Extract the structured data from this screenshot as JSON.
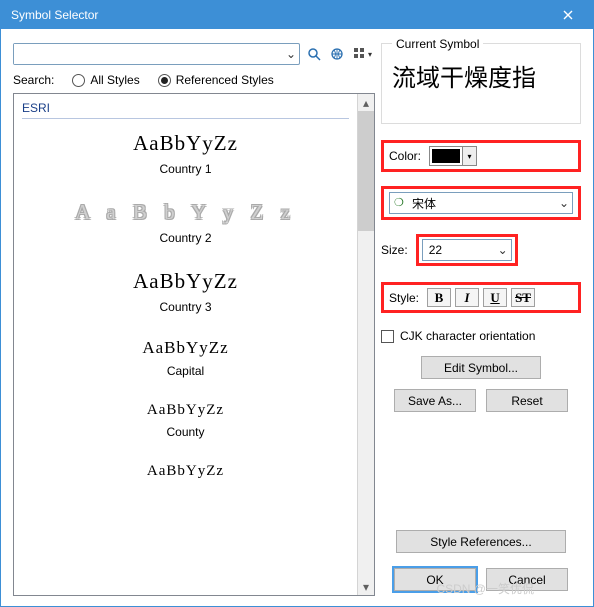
{
  "title": "Symbol Selector",
  "search": {
    "label": "Search:",
    "value": "",
    "all": "All Styles",
    "ref": "Referenced Styles",
    "mode": "ref"
  },
  "group": "ESRI",
  "samples": [
    {
      "text": "AaBbYyZz",
      "label": "Country 1",
      "style": "serif"
    },
    {
      "text": "A a B b Y y Z z",
      "label": "Country 2",
      "style": "outline"
    },
    {
      "text": "AaBbYyZz",
      "label": "Country 3",
      "style": "serif"
    },
    {
      "text": "AaBbYyZz",
      "label": "Capital",
      "style": "serifsmall"
    },
    {
      "text": "AaBbYyZz",
      "label": "County",
      "style": "serifsmall"
    },
    {
      "text": "AaBbYyZz",
      "label": "",
      "style": "serifsmall"
    }
  ],
  "panel": {
    "legend": "Current Symbol",
    "preview": "流域干燥度指",
    "color": "Color:",
    "color_value": "#000000",
    "font": "宋体",
    "size_label": "Size:",
    "size": "22",
    "style_label": "Style:",
    "cjk": "CJK character orientation",
    "edit": "Edit Symbol...",
    "saveas": "Save As...",
    "reset": "Reset",
    "stylerefs": "Style References...",
    "ok": "OK",
    "cancel": "Cancel"
  },
  "watermark": "CSDN @一笑优侃"
}
